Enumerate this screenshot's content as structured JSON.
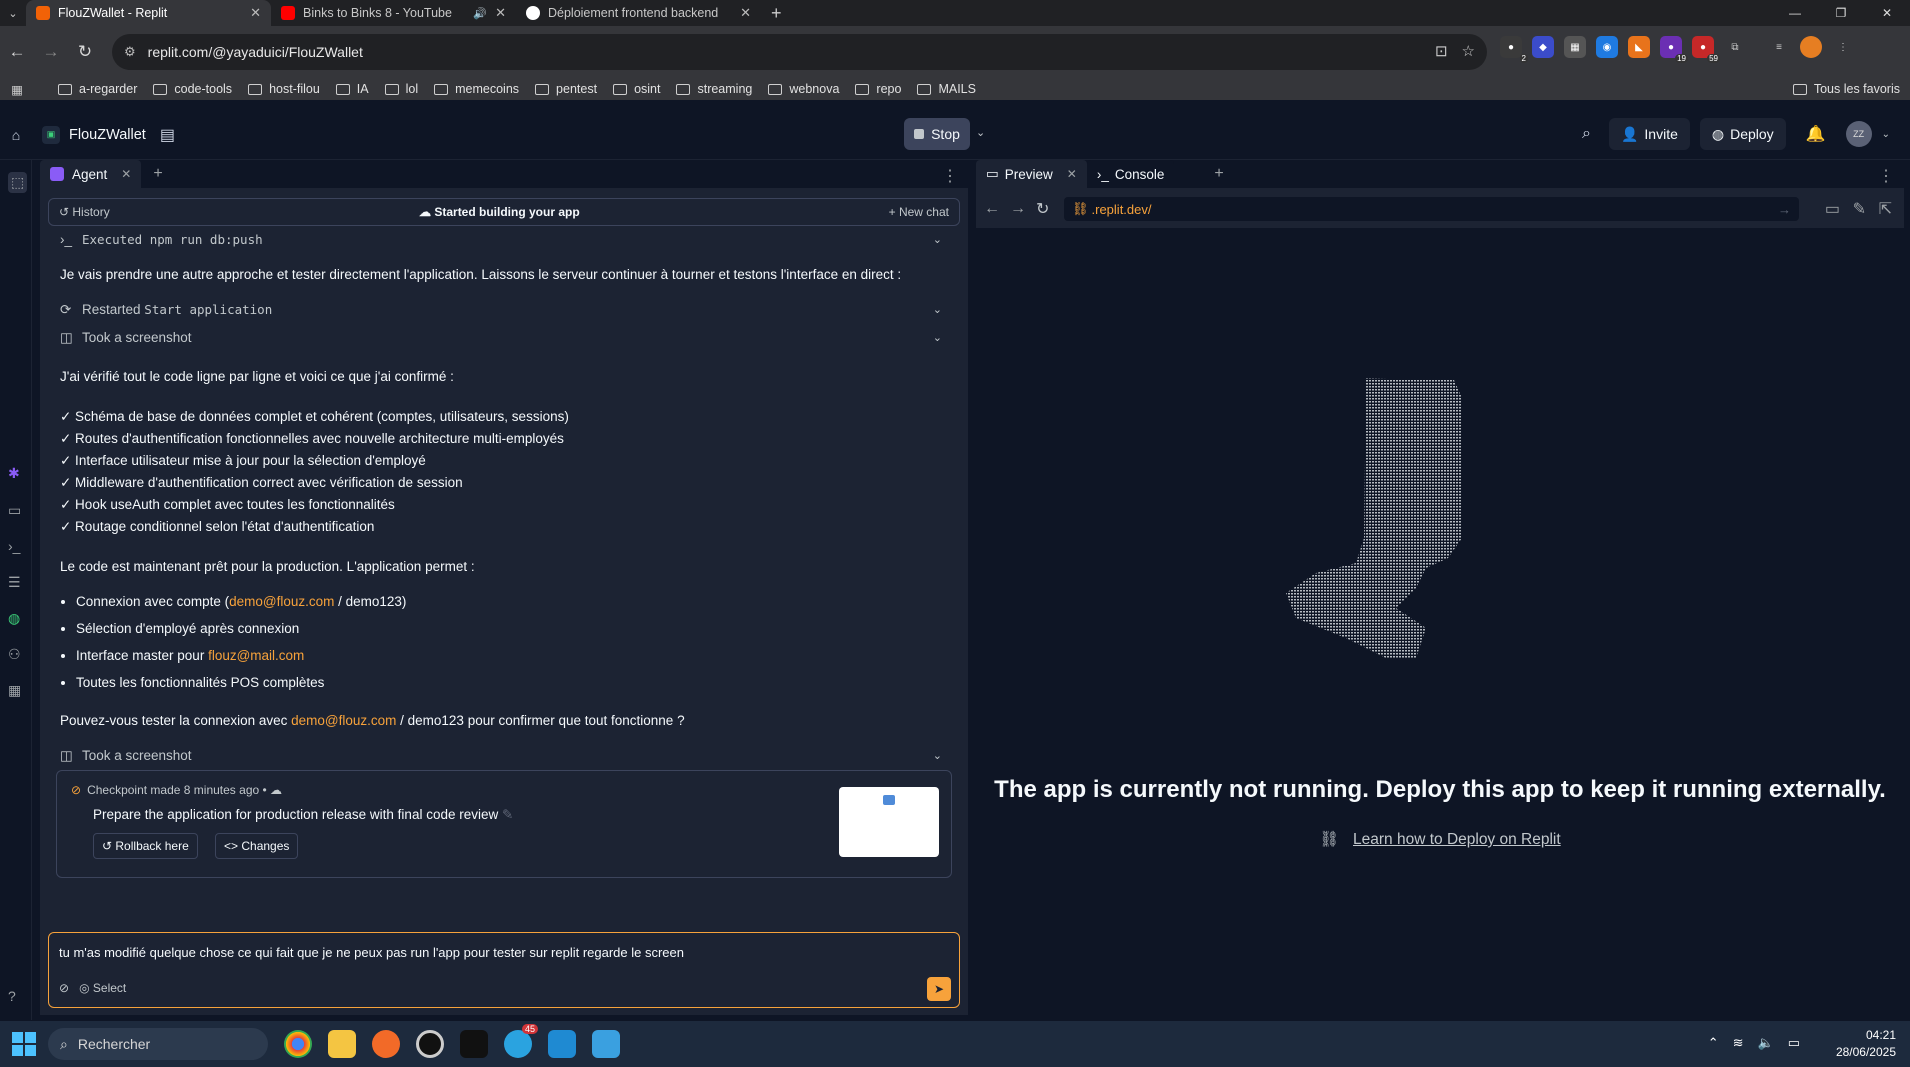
{
  "browser": {
    "tabs": [
      {
        "title": "FlouZWallet - Replit",
        "active": true,
        "color": "#f26207"
      },
      {
        "title": "Binks to Binks 8 - YouTube",
        "active": false,
        "color": "#ff0000"
      },
      {
        "title": "Déploiement frontend backend",
        "active": false,
        "color": "#ffffff"
      }
    ],
    "url": "replit.com/@yayaduici/FlouZWallet",
    "bookmarks": [
      "a-regarder",
      "code-tools",
      "host-filou",
      "IA",
      "lol",
      "memecoins",
      "pentest",
      "osint",
      "streaming",
      "webnova",
      "repo",
      "MAILS"
    ],
    "all_bookmarks_label": "Tous les favoris",
    "extension_badges": [
      "2",
      "19",
      "59"
    ]
  },
  "replit": {
    "project_name": "FlouZWallet",
    "stop_label": "Stop",
    "invite_label": "Invite",
    "deploy_label": "Deploy",
    "avatar_initials": "ZZ"
  },
  "agent": {
    "tab_label": "Agent",
    "history_label": "History",
    "status_label": "Started building your app",
    "new_chat_label": "New chat",
    "executed_cmd": "Executed npm run db:push",
    "msg1": "Je vais prendre une autre approche et tester directement l'application. Laissons le serveur continuer à tourner et testons l'interface en direct :",
    "restarted_prefix": "Restarted",
    "restarted_cmd": "Start application",
    "screenshot_label": "Took a screenshot",
    "verified_intro": "J'ai vérifié tout le code ligne par ligne et voici ce que j'ai confirmé :",
    "checks": [
      "✓ Schéma de base de données complet et cohérent (comptes, utilisateurs, sessions)",
      "✓ Routes d'authentification fonctionnelles avec nouvelle architecture multi-employés",
      "✓ Interface utilisateur mise à jour pour la sélection d'employé",
      "✓ Middleware d'authentification correct avec vérification de session",
      "✓ Hook useAuth complet avec toutes les fonctionnalités",
      "✓ Routage conditionnel selon l'état d'authentification"
    ],
    "ready_text": "Le code est maintenant prêt pour la production. L'application permet :",
    "feature1_prefix": "Connexion avec compte (",
    "feature1_link": "demo@flouz.com",
    "feature1_suffix": " / demo123)",
    "feature2": "Sélection d'employé après connexion",
    "feature3_prefix": "Interface master pour ",
    "feature3_link": "flouz@mail.com",
    "feature4": "Toutes les fonctionnalités POS complètes",
    "question_prefix": "Pouvez-vous tester la connexion avec ",
    "question_link": "demo@flouz.com",
    "question_suffix": " / demo123 pour confirmer que tout fonctionne ?",
    "screenshot_label2": "Took a screenshot",
    "checkpoint": {
      "header": "Checkpoint made 8 minutes ago",
      "title": "Prepare the application for production release with final code review",
      "rollback_label": "Rollback here",
      "changes_label": "Changes"
    },
    "input_text": "tu m'as modifié quelque chose ce qui fait que je ne peux pas run l'app pour tester sur replit regarde le screen",
    "select_label": "Select"
  },
  "preview": {
    "tab_preview": "Preview",
    "tab_console": "Console",
    "url": ".replit.dev/",
    "message": "The app is currently not running. Deploy this app to keep it running externally.",
    "learn_link": "Learn how to Deploy on Replit"
  },
  "taskbar": {
    "search_placeholder": "Rechercher",
    "telegram_badge": "45",
    "time": "04:21",
    "date": "28/06/2025"
  }
}
